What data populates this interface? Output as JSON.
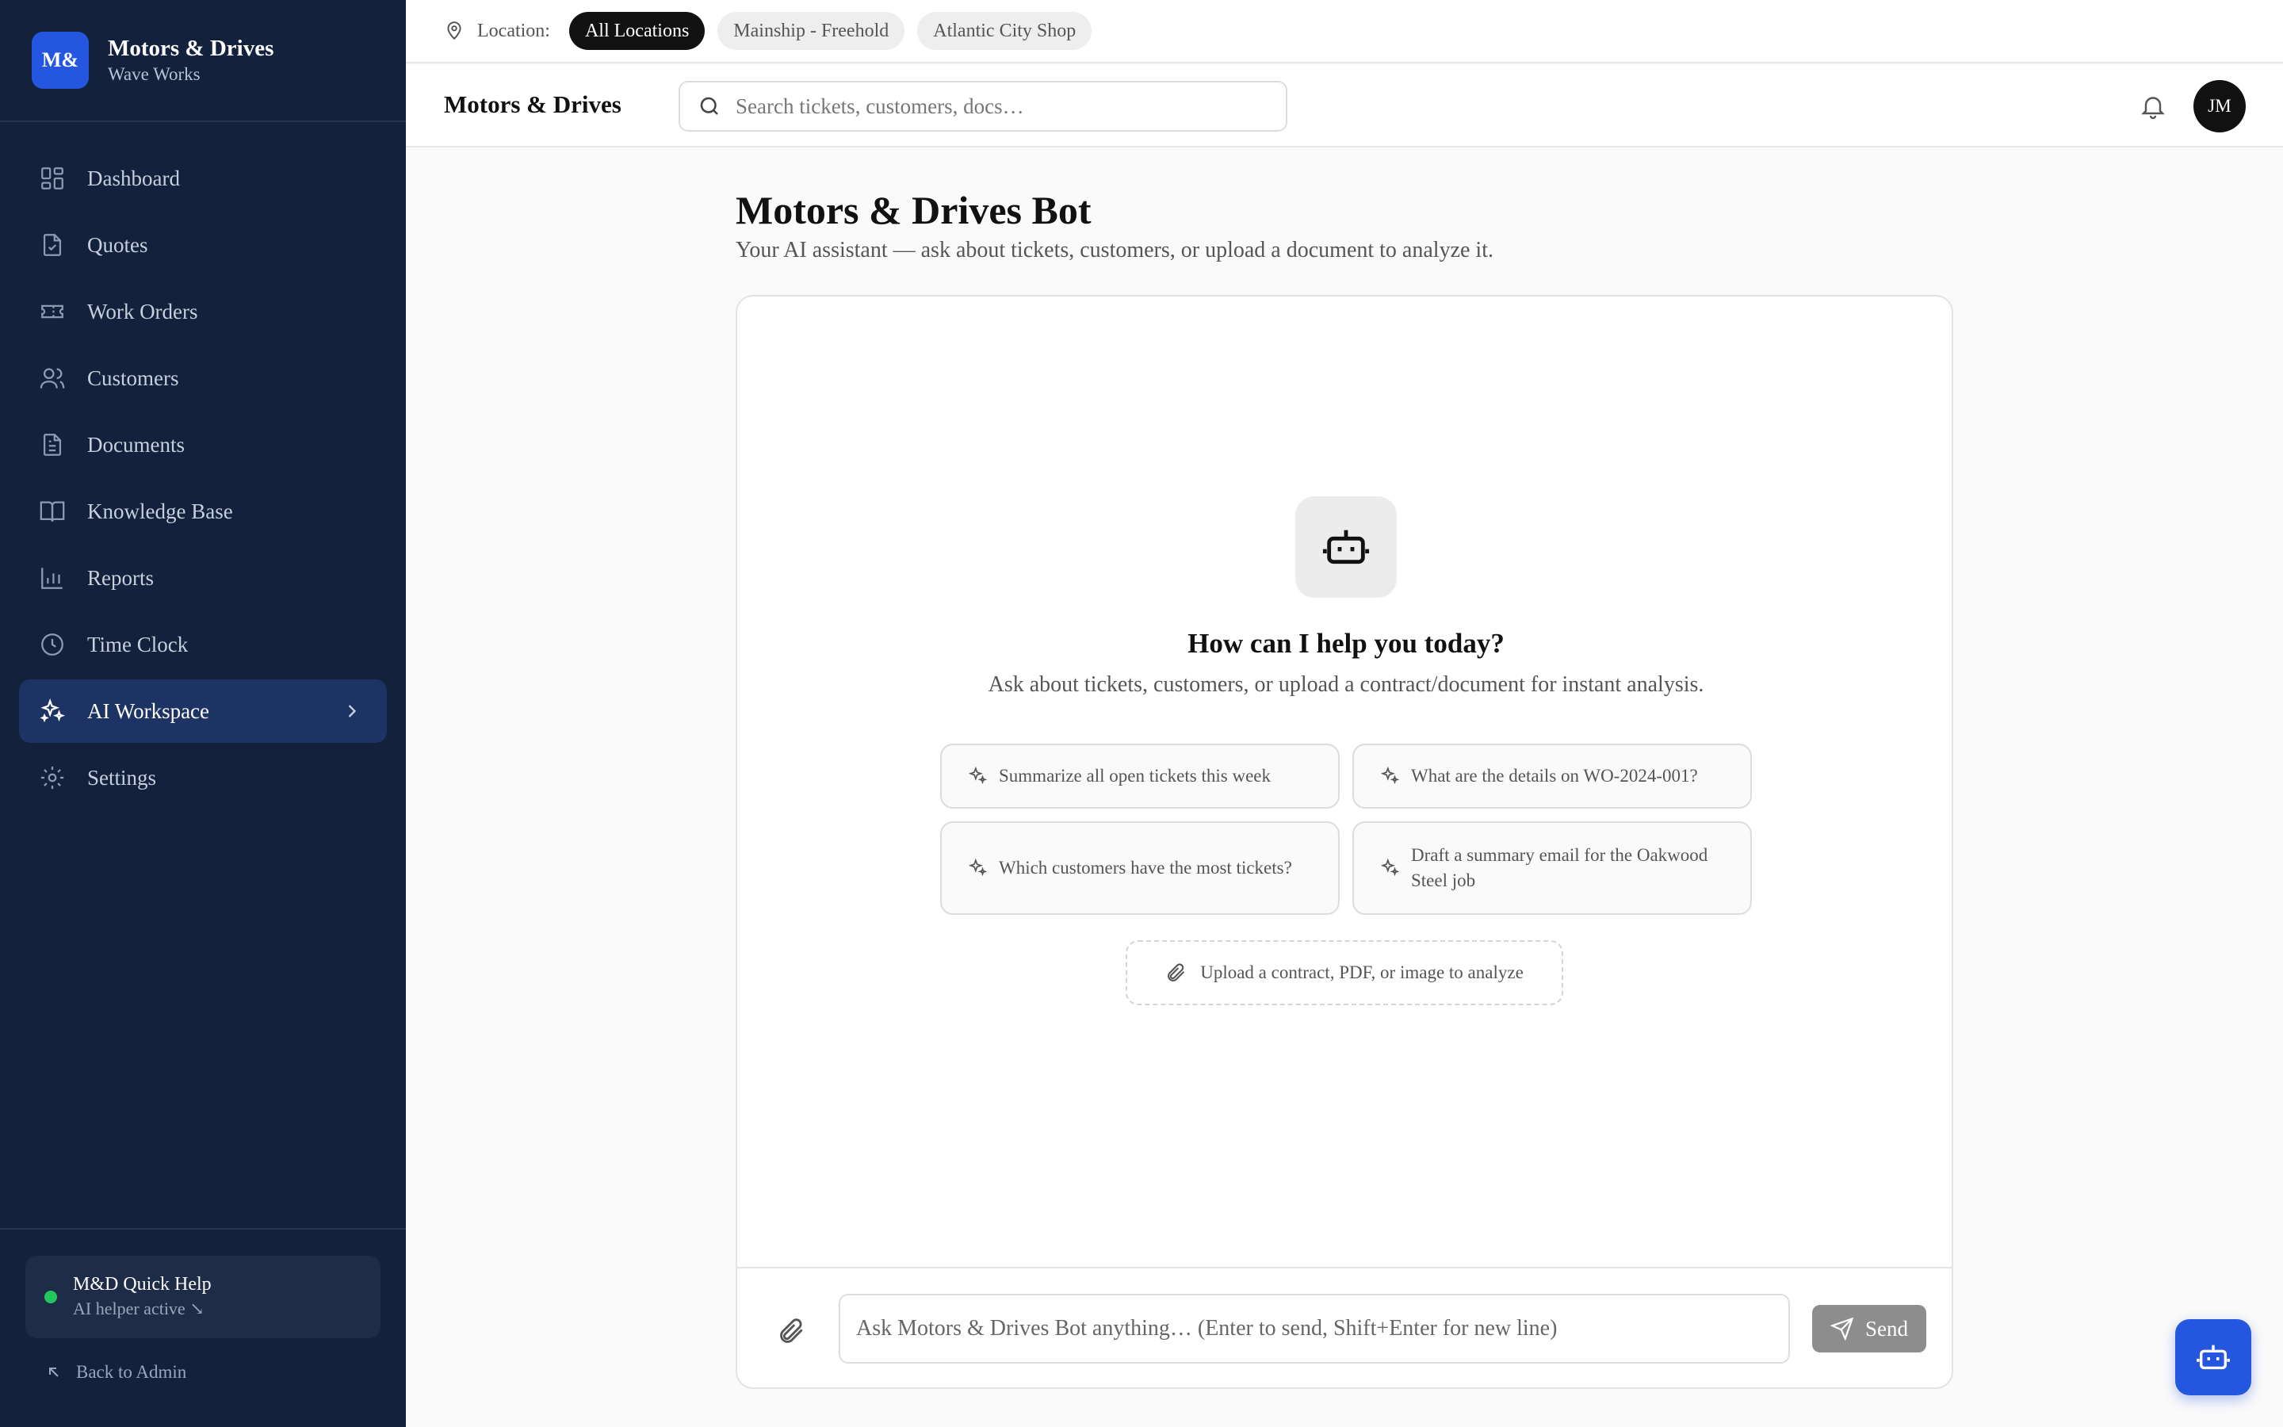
{
  "brand": {
    "logo": "M&",
    "title": "Motors & Drives",
    "subtitle": "Wave Works"
  },
  "sidebar": {
    "items": [
      {
        "label": "Dashboard",
        "icon": "dashboard-icon"
      },
      {
        "label": "Quotes",
        "icon": "quote-icon"
      },
      {
        "label": "Work Orders",
        "icon": "ticket-icon"
      },
      {
        "label": "Customers",
        "icon": "users-icon"
      },
      {
        "label": "Documents",
        "icon": "document-icon"
      },
      {
        "label": "Knowledge Base",
        "icon": "book-icon"
      },
      {
        "label": "Reports",
        "icon": "bar-chart-icon"
      },
      {
        "label": "Time Clock",
        "icon": "clock-icon"
      },
      {
        "label": "AI Workspace",
        "icon": "sparkles-icon",
        "active": true
      },
      {
        "label": "Settings",
        "icon": "gear-icon"
      }
    ],
    "quick_help": {
      "title": "M&D Quick Help",
      "status": "AI helper active ↘"
    },
    "back_label": "Back to Admin"
  },
  "location_bar": {
    "label": "Location:",
    "options": [
      "All Locations",
      "Mainship - Freehold",
      "Atlantic City Shop"
    ],
    "selected": "All Locations"
  },
  "header": {
    "title": "Motors & Drives",
    "search_placeholder": "Search tickets, customers, docs…",
    "avatar_initials": "JM"
  },
  "main": {
    "title": "Motors & Drives Bot",
    "subtitle": "Your AI assistant — ask about tickets, customers, or upload a document to analyze it.",
    "empty_title": "How can I help you today?",
    "empty_subtitle": "Ask about tickets, customers, or upload a contract/document for instant analysis.",
    "suggestions": [
      "Summarize all open tickets this week",
      "What are the details on WO-2024-001?",
      "Which customers have the most tickets?",
      "Draft a summary email for the Oakwood Steel job"
    ],
    "upload_label": "Upload a contract, PDF, or image to analyze",
    "composer_placeholder": "Ask Motors & Drives Bot anything… (Enter to send, Shift+Enter for new line)",
    "send_label": "Send"
  },
  "colors": {
    "sidebar_bg": "#13213d",
    "active_nav_bg": "#1d3363",
    "accent": "#2456e0",
    "status_active": "#22c55e",
    "send_disabled": "#8d8d8d"
  }
}
